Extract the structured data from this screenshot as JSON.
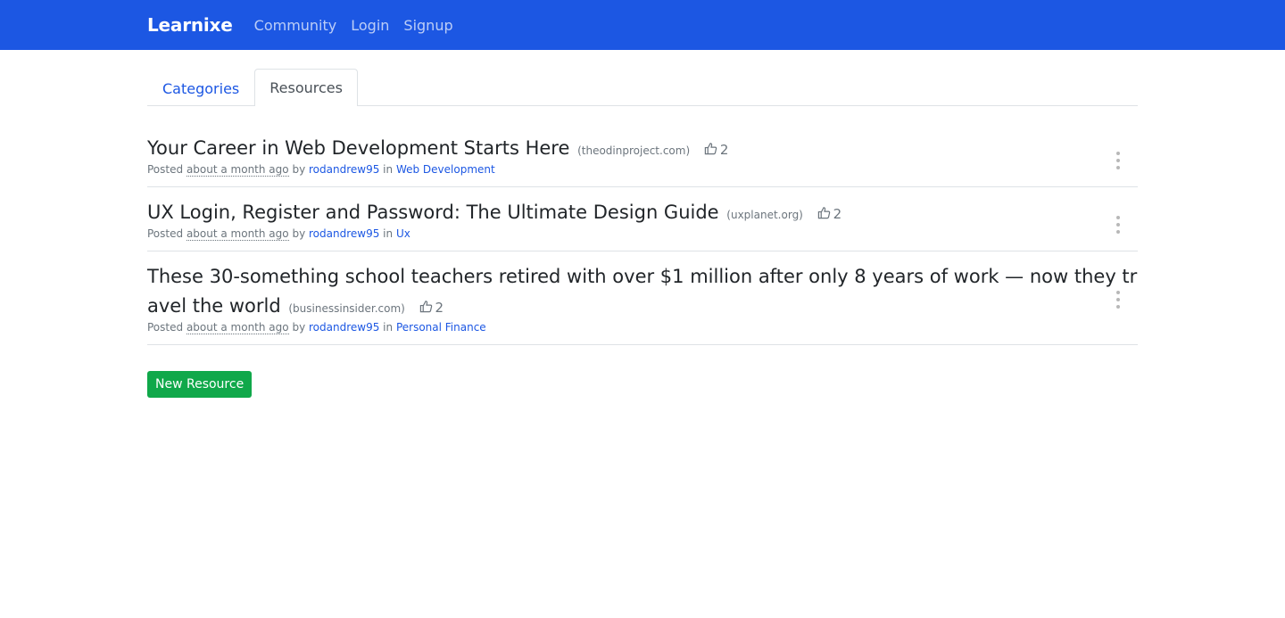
{
  "nav": {
    "brand": "Learnixe",
    "links": [
      "Community",
      "Login",
      "Signup"
    ]
  },
  "tabs": [
    {
      "label": "Categories",
      "active": false
    },
    {
      "label": "Resources",
      "active": true
    }
  ],
  "resources": [
    {
      "title": "Your Career in Web Development Starts Here",
      "domain": "(theodinproject.com)",
      "likes": "2",
      "posted": "Posted",
      "time": "about a month ago",
      "by": "by",
      "author": "rodandrew95",
      "in": "in",
      "category": "Web Development"
    },
    {
      "title": "UX Login, Register and Password: The Ultimate Design Guide",
      "domain": "(uxplanet.org)",
      "likes": "2",
      "posted": "Posted",
      "time": "about a month ago",
      "by": "by",
      "author": "rodandrew95",
      "in": "in",
      "category": "Ux"
    },
    {
      "title": "These 30-something school teachers retired with over $1 million after only 8 years of work — now they travel the world",
      "domain": "(businessinsider.com)",
      "likes": "2",
      "posted": "Posted",
      "time": "about a month ago",
      "by": "by",
      "author": "rodandrew95",
      "in": "in",
      "category": "Personal Finance"
    }
  ],
  "new_resource_label": "New Resource",
  "colors": {
    "navbar": "#1c57e3",
    "link": "#1c57e3",
    "button": "#10a84a"
  },
  "icons": {
    "like": "thumbs-up-icon",
    "menu": "kebab-menu-icon"
  }
}
